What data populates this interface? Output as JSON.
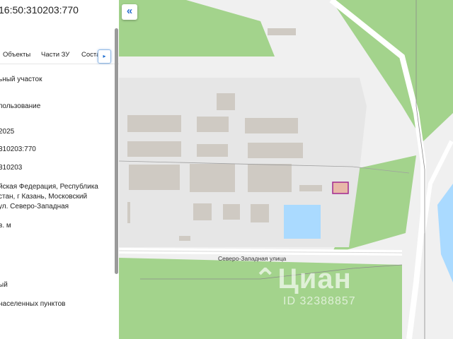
{
  "panel": {
    "cadastral_number": "16:50:310203:770",
    "tabs": [
      {
        "label": "Объекты"
      },
      {
        "label": "Части ЗУ"
      },
      {
        "label": "Соста"
      }
    ],
    "tab_arrow": "▸",
    "fields": [
      "ьный участок",
      "пользование",
      "2025",
      "310203:770",
      "310203",
      "йская Федерация, Республика",
      "стан, г Казань, Московский",
      "ул. Северо-Западная",
      "в. м",
      "ый",
      "населенных пунктов"
    ]
  },
  "map": {
    "collapse_icon": "«",
    "street_label": "Северо-Западная улица",
    "watermark_logo": "⌃Циан",
    "watermark_id": "ID 32388857",
    "colors": {
      "green": "#a3d38c",
      "building": "#cfcac3",
      "industrial": "#e6e6e6",
      "water": "#aadaff",
      "parcel": "#a3298f"
    }
  }
}
